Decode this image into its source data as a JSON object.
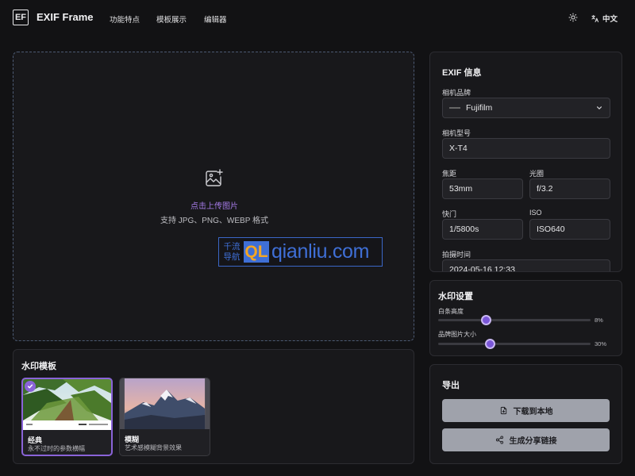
{
  "header": {
    "logo_text": "EF",
    "app_title": "EXIF Frame",
    "nav": [
      "功能特点",
      "模板展示",
      "编辑器"
    ],
    "language_label": "中文"
  },
  "upload": {
    "title": "点击上传图片",
    "subtitle": "支持 JPG、PNG、WEBP 格式"
  },
  "watermark_overlay": {
    "cn_line1": "千流",
    "cn_line2": "导航",
    "badge": "QL",
    "domain": "qianliu.com"
  },
  "templates": {
    "title": "水印模板",
    "items": [
      {
        "name": "经典",
        "desc": "永不过时的参数横幅",
        "selected": true
      },
      {
        "name": "模糊",
        "desc": "艺术感模糊背景效果",
        "selected": false
      }
    ]
  },
  "exif": {
    "title": "EXIF 信息",
    "brand_label": "相机品牌",
    "brand_value": "Fujifilm",
    "model_label": "相机型号",
    "model_value": "X-T4",
    "focal_label": "焦距",
    "focal_value": "53mm",
    "aperture_label": "光圈",
    "aperture_value": "f/3.2",
    "shutter_label": "快门",
    "shutter_value": "1/5800s",
    "iso_label": "ISO",
    "iso_value": "ISO640",
    "time_label": "拍摄时间",
    "time_value": "2024-05-16 12:33"
  },
  "watermark_settings": {
    "title": "水印设置",
    "sliders": [
      {
        "label": "白条高度",
        "value_text": "8%",
        "fraction": 0.31
      },
      {
        "label": "品牌图片大小",
        "value_text": "30%",
        "fraction": 0.34
      }
    ]
  },
  "export": {
    "title": "导出",
    "download_label": "下载到本地",
    "share_label": "生成分享链接"
  },
  "colors": {
    "accent": "#8a63d8",
    "background": "#121214",
    "panel": "#18181b",
    "button": "#9fa2ab"
  }
}
